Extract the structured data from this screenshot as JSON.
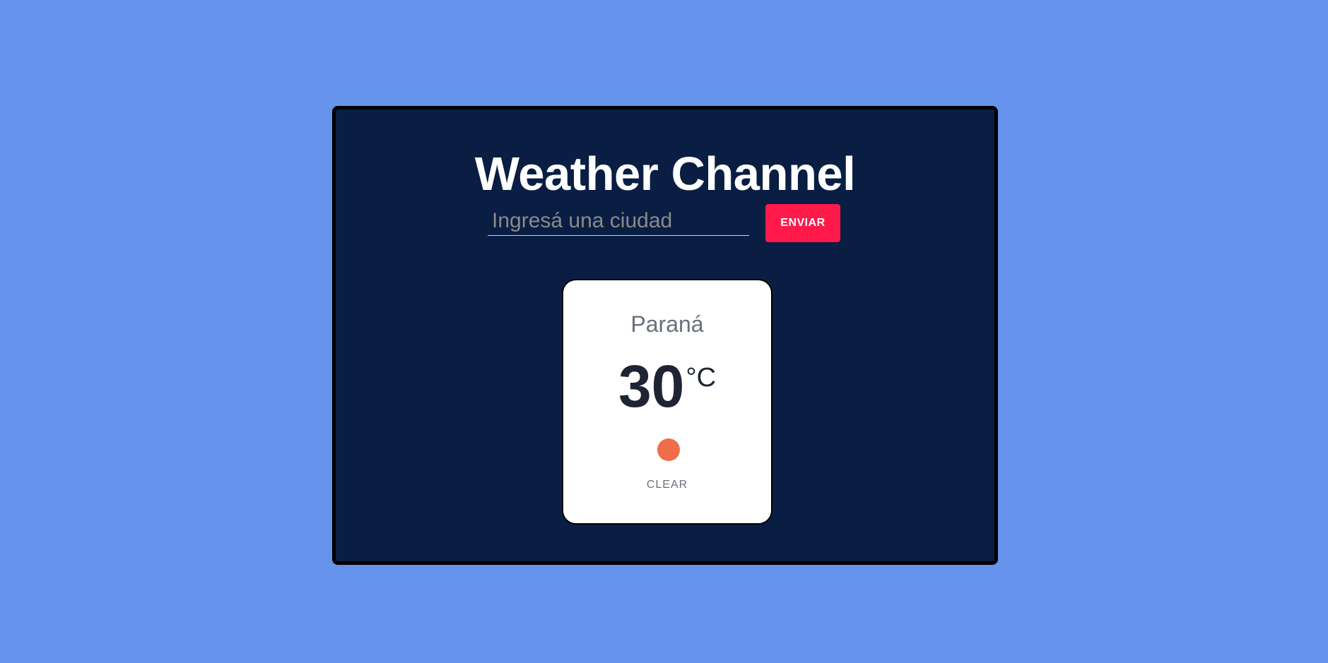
{
  "app": {
    "title": "Weather Channel"
  },
  "search": {
    "placeholder": "Ingresá una ciudad",
    "value": "",
    "button_label": "ENVIAR"
  },
  "weather": {
    "city": "Paraná",
    "temperature": "30",
    "unit": "°C",
    "condition": "CLEAR",
    "condition_icon": "clear-sun-icon",
    "icon_color": "#ee6e4a"
  },
  "colors": {
    "page_background": "#6694ec",
    "panel_background": "#0a1e44",
    "accent_button": "#ff1a4a",
    "card_background": "#ffffff"
  }
}
